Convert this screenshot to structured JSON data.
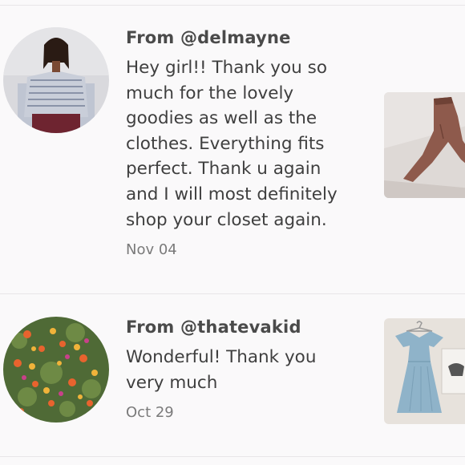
{
  "reviews": [
    {
      "from": "From @delmayne",
      "message_lines": [
        "Hey girl!! Thank you so",
        "much for the lovely",
        "goodies as well as the",
        "clothes. Everything fits",
        "perfect. Thank u again",
        "and I will most definitely",
        "shop your closet again."
      ],
      "date": "Nov 04",
      "avatar_icon": "user-photo-avatar",
      "thumbnail_icon": "brown-pants-photo"
    },
    {
      "from": "From @thatevakid",
      "message_lines": [
        "Wonderful! Thank you",
        "very much"
      ],
      "date": "Oct 29",
      "avatar_icon": "flowers-photo-avatar",
      "thumbnail_icon": "blue-dress-photo"
    }
  ]
}
